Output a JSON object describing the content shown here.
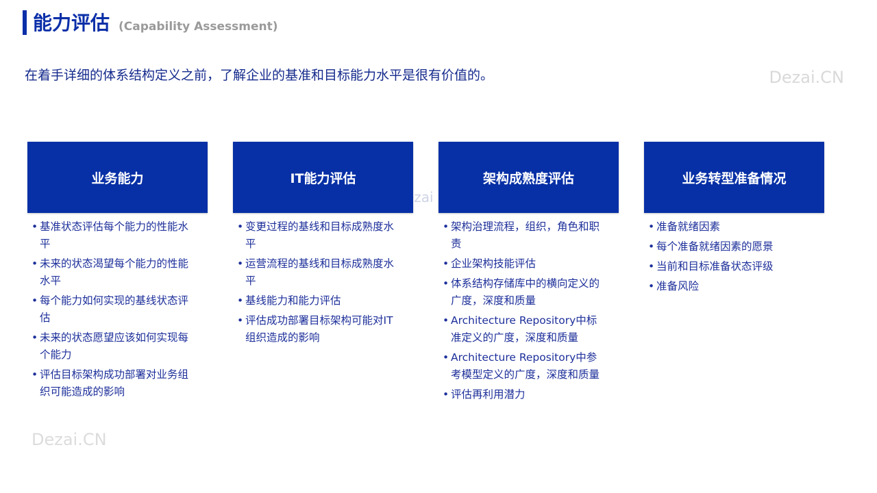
{
  "header": {
    "title": "能力评估",
    "subtitle": "(Capability  Assessment)"
  },
  "intro": "在着手详细的体系结构定义之前，了解企业的基准和目标能力水平是很有价值的。",
  "watermarks": [
    "Dezai.CN",
    "Dezai.CN",
    "ezai"
  ],
  "cards": [
    {
      "title": "业务能力",
      "items": [
        "基准状态评估每个能力的性能水平",
        "未来的状态渴望每个能力的性能水平",
        "每个能力如何实现的基线状态评估",
        "未来的状态愿望应该如何实现每个能力",
        "评估目标架构成功部署对业务组织可能造成的影响"
      ]
    },
    {
      "title": "IT能力评估",
      "items": [
        "变更过程的基线和目标成熟度水平",
        "运营流程的基线和目标成熟度水平",
        "基线能力和能力评估",
        "评估成功部署目标架构可能对IT组织造成的影响"
      ]
    },
    {
      "title": "架构成熟度评估",
      "items": [
        "架构治理流程，组织，角色和职责",
        "企业架构技能评估",
        "体系结构存储库中的横向定义的广度，深度和质量",
        "Architecture Repository中标准定义的广度，深度和质量",
        "Architecture Repository中参考模型定义的广度，深度和质量",
        "评估再利用潜力"
      ]
    },
    {
      "title": "业务转型准备情况",
      "items": [
        "准备就绪因素",
        "每个准备就绪因素的愿景",
        "当前和目标准备状态评级",
        "准备风险"
      ]
    }
  ]
}
